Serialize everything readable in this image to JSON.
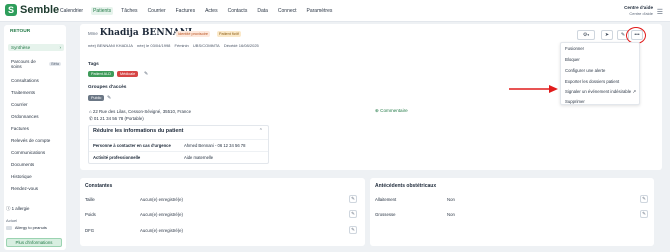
{
  "app": {
    "logo_letter": "S",
    "name": "Semble",
    "brand_color": "#2e9e5b"
  },
  "nav": [
    "Calendrier",
    "Patients",
    "Tâches",
    "Courrier",
    "Factures",
    "Actes",
    "Contacts",
    "Data",
    "Connect",
    "Paramètres"
  ],
  "nav_active": "Patients",
  "centre": {
    "name": "Centre d'aide",
    "sub": "Centre d'aide"
  },
  "sidebar": {
    "back": "RETOUR",
    "items": [
      {
        "label": "Synthèse",
        "active": true
      },
      {
        "label": "Parcours de soins",
        "badge": "Bêta"
      },
      {
        "label": "Consultations"
      },
      {
        "label": "Traitements"
      },
      {
        "label": "Courrier"
      },
      {
        "label": "Ordonnances"
      },
      {
        "label": "Factures"
      },
      {
        "label": "Relevés de compte"
      },
      {
        "label": "Communications"
      },
      {
        "label": "Documents"
      },
      {
        "label": "Historique"
      },
      {
        "label": "Rendez-vous"
      }
    ],
    "allergy_count": "1 allergie",
    "allergy_section": "Actuel",
    "allergy_item": "Allergy to peanuts",
    "more_info": "Plus d'informations"
  },
  "patient": {
    "civility": "Mme",
    "name": "Khadija BENNANI",
    "badge_provisional": "Identité provisoire",
    "badge_fictif": "Patient fictif",
    "identity": [
      "née) BENNANI KHADIJA",
      "née) le 03/04/1998",
      "Féminin",
      "UBS/COMMTA",
      "Décédé 16/08/2025"
    ],
    "tags_title": "Tags",
    "tags": [
      {
        "label": "Patient ALD",
        "color": "green"
      },
      {
        "label": "Médicale",
        "color": "red"
      }
    ],
    "groups_title": "Groupes d'accès",
    "groups": [
      "Public"
    ],
    "address": "22 Rue des Lilas, Cesson-Sévigné, 35510, France",
    "phone": "01 21 34 56 78 (Portable)",
    "comment_label": "Commentaire",
    "reduce_title": "Réduire les informations du patient",
    "details": [
      {
        "key": "Personne à contacter en cas d'urgence",
        "value": "Ahmed Bennani - 06 12 34 56 78"
      },
      {
        "key": "Activité professionnelle",
        "value": "Aide maternelle"
      }
    ]
  },
  "action_icons": [
    "settings-icon",
    "send-icon",
    "edit-icon",
    "more-icon"
  ],
  "more_menu": [
    "Fusionner",
    "Bloquer",
    "Configurer une alerte",
    "Exporter les dossiers patient",
    "Signaler un événement indésirable",
    "Supprimer"
  ],
  "constantes": {
    "title": "Constantes",
    "rows": [
      {
        "label": "Taille",
        "value": "Aucun(e) enregistré(e)"
      },
      {
        "label": "Poids",
        "value": "Aucun(e) enregistré(e)"
      },
      {
        "label": "DFG",
        "value": "Aucun(e) enregistré(e)"
      }
    ]
  },
  "obstetric": {
    "title": "Antécédents obstétricaux",
    "rows": [
      {
        "label": "Allaitement",
        "value": "Non"
      },
      {
        "label": "Grossesse",
        "value": "Non"
      }
    ]
  }
}
